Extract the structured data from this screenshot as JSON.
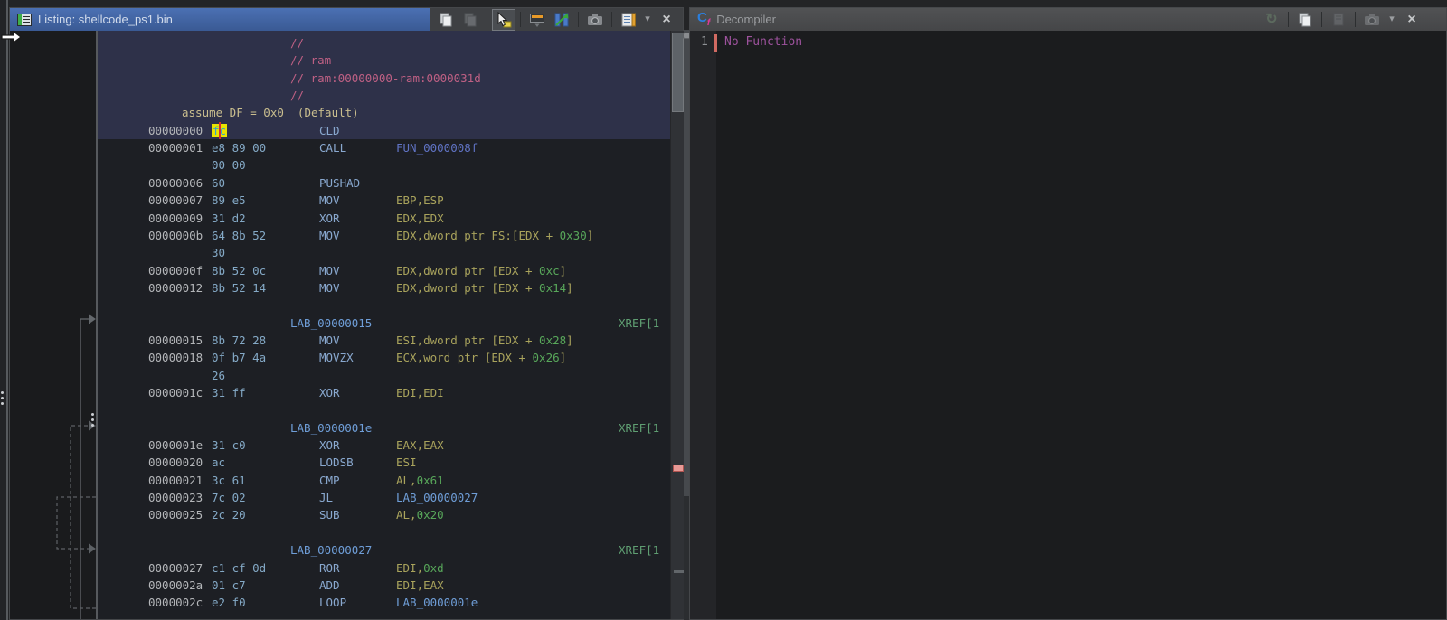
{
  "listing": {
    "title": "Listing:  shellcode_ps1.bin",
    "toolbar_icons": [
      "copy-icon",
      "paste-icon",
      "select-tool-icon",
      "edit-listing-fields-icon",
      "diff-view-icon",
      "snapshot-icon",
      "listing-display-options-icon",
      "dropdown-caret-icon",
      "close-icon"
    ],
    "header_icon": "listing-icon",
    "assume_line": "assume DF = 0x0  (Default)",
    "cursor_byte": "fc",
    "rows": [
      [
        {
          "c": "com",
          "p": [
            [
              "com",
              "//"
            ]
          ]
        }
      ],
      [
        {
          "c": "com",
          "p": [
            [
              "com",
              "// ram"
            ]
          ]
        }
      ],
      [
        {
          "c": "com",
          "p": [
            [
              "com",
              "// ram:00000000-ram:0000031d"
            ]
          ]
        }
      ],
      [
        {
          "c": "com",
          "p": [
            [
              "com",
              "//"
            ]
          ]
        }
      ],
      [
        {
          "c": "assume",
          "p": [
            [
              "assume",
              "assume DF = 0x0  (Default)"
            ]
          ]
        }
      ],
      [
        {
          "c": "addr",
          "p": [
            [
              "addr",
              "00000000"
            ]
          ]
        },
        {
          "c": "bytehl",
          "p": [
            [
              "bytehl",
              "fc"
            ]
          ]
        },
        {
          "c": "mnem",
          "p": [
            [
              "mnem",
              "CLD"
            ]
          ]
        }
      ],
      [
        {
          "c": "addr",
          "p": [
            [
              "addr",
              "00000001"
            ]
          ]
        },
        {
          "c": "byte",
          "p": [
            [
              "byte",
              "e8 89 00"
            ]
          ]
        },
        {
          "c": "mnem",
          "p": [
            [
              "mnem",
              "CALL"
            ]
          ]
        },
        {
          "c": "op",
          "p": [
            [
              "fun",
              "FUN_0000008f"
            ]
          ]
        }
      ],
      [
        {
          "c": "byte",
          "p": [
            [
              "byte",
              "00 00"
            ]
          ]
        }
      ],
      [
        {
          "c": "addr",
          "p": [
            [
              "addr",
              "00000006"
            ]
          ]
        },
        {
          "c": "byte",
          "p": [
            [
              "byte",
              "60"
            ]
          ]
        },
        {
          "c": "mnem",
          "p": [
            [
              "mnem",
              "PUSHAD"
            ]
          ]
        }
      ],
      [
        {
          "c": "addr",
          "p": [
            [
              "addr",
              "00000007"
            ]
          ]
        },
        {
          "c": "byte",
          "p": [
            [
              "byte",
              "89 e5"
            ]
          ]
        },
        {
          "c": "mnem",
          "p": [
            [
              "mnem",
              "MOV"
            ]
          ]
        },
        {
          "c": "op",
          "p": [
            [
              "reg",
              "EBP,ESP"
            ]
          ]
        }
      ],
      [
        {
          "c": "addr",
          "p": [
            [
              "addr",
              "00000009"
            ]
          ]
        },
        {
          "c": "byte",
          "p": [
            [
              "byte",
              "31 d2"
            ]
          ]
        },
        {
          "c": "mnem",
          "p": [
            [
              "mnem",
              "XOR"
            ]
          ]
        },
        {
          "c": "op",
          "p": [
            [
              "reg",
              "EDX,EDX"
            ]
          ]
        }
      ],
      [
        {
          "c": "addr",
          "p": [
            [
              "addr",
              "0000000b"
            ]
          ]
        },
        {
          "c": "byte",
          "p": [
            [
              "byte",
              "64 8b 52"
            ]
          ]
        },
        {
          "c": "mnem",
          "p": [
            [
              "mnem",
              "MOV"
            ]
          ]
        },
        {
          "c": "op",
          "p": [
            [
              "reg",
              "EDX,dword ptr FS:[EDX + "
            ],
            [
              "num",
              "0x30"
            ],
            [
              "reg",
              "]"
            ]
          ]
        }
      ],
      [
        {
          "c": "byte",
          "p": [
            [
              "byte",
              "30"
            ]
          ]
        }
      ],
      [
        {
          "c": "addr",
          "p": [
            [
              "addr",
              "0000000f"
            ]
          ]
        },
        {
          "c": "byte",
          "p": [
            [
              "byte",
              "8b 52 0c"
            ]
          ]
        },
        {
          "c": "mnem",
          "p": [
            [
              "mnem",
              "MOV"
            ]
          ]
        },
        {
          "c": "op",
          "p": [
            [
              "reg",
              "EDX,dword ptr [EDX + "
            ],
            [
              "num",
              "0xc"
            ],
            [
              "reg",
              "]"
            ]
          ]
        }
      ],
      [
        {
          "c": "addr",
          "p": [
            [
              "addr",
              "00000012"
            ]
          ]
        },
        {
          "c": "byte",
          "p": [
            [
              "byte",
              "8b 52 14"
            ]
          ]
        },
        {
          "c": "mnem",
          "p": [
            [
              "mnem",
              "MOV"
            ]
          ]
        },
        {
          "c": "op",
          "p": [
            [
              "reg",
              "EDX,dword ptr [EDX + "
            ],
            [
              "num",
              "0x14"
            ],
            [
              "reg",
              "]"
            ]
          ]
        }
      ],
      [],
      [
        {
          "c": "lab",
          "p": [
            [
              "lab",
              "LAB_00000015"
            ]
          ]
        },
        {
          "c": "xref",
          "p": [
            [
              "xref",
              "XREF[1"
            ]
          ]
        }
      ],
      [
        {
          "c": "addr",
          "p": [
            [
              "addr",
              "00000015"
            ]
          ]
        },
        {
          "c": "byte",
          "p": [
            [
              "byte",
              "8b 72 28"
            ]
          ]
        },
        {
          "c": "mnem",
          "p": [
            [
              "mnem",
              "MOV"
            ]
          ]
        },
        {
          "c": "op",
          "p": [
            [
              "reg",
              "ESI,dword ptr [EDX + "
            ],
            [
              "num",
              "0x28"
            ],
            [
              "reg",
              "]"
            ]
          ]
        }
      ],
      [
        {
          "c": "addr",
          "p": [
            [
              "addr",
              "00000018"
            ]
          ]
        },
        {
          "c": "byte",
          "p": [
            [
              "byte",
              "0f b7 4a"
            ]
          ]
        },
        {
          "c": "mnem",
          "p": [
            [
              "mnem",
              "MOVZX"
            ]
          ]
        },
        {
          "c": "op",
          "p": [
            [
              "reg",
              "ECX,word ptr [EDX + "
            ],
            [
              "num",
              "0x26"
            ],
            [
              "reg",
              "]"
            ]
          ]
        }
      ],
      [
        {
          "c": "byte",
          "p": [
            [
              "byte",
              "26"
            ]
          ]
        }
      ],
      [
        {
          "c": "addr",
          "p": [
            [
              "addr",
              "0000001c"
            ]
          ]
        },
        {
          "c": "byte",
          "p": [
            [
              "byte",
              "31 ff"
            ]
          ]
        },
        {
          "c": "mnem",
          "p": [
            [
              "mnem",
              "XOR"
            ]
          ]
        },
        {
          "c": "op",
          "p": [
            [
              "reg",
              "EDI,EDI"
            ]
          ]
        }
      ],
      [],
      [
        {
          "c": "lab",
          "p": [
            [
              "lab",
              "LAB_0000001e"
            ]
          ]
        },
        {
          "c": "xref",
          "p": [
            [
              "xref",
              "XREF[1"
            ]
          ]
        }
      ],
      [
        {
          "c": "addr",
          "p": [
            [
              "addr",
              "0000001e"
            ]
          ]
        },
        {
          "c": "byte",
          "p": [
            [
              "byte",
              "31 c0"
            ]
          ]
        },
        {
          "c": "mnem",
          "p": [
            [
              "mnem",
              "XOR"
            ]
          ]
        },
        {
          "c": "op",
          "p": [
            [
              "reg",
              "EAX,EAX"
            ]
          ]
        }
      ],
      [
        {
          "c": "addr",
          "p": [
            [
              "addr",
              "00000020"
            ]
          ]
        },
        {
          "c": "byte",
          "p": [
            [
              "byte",
              "ac"
            ]
          ]
        },
        {
          "c": "mnem",
          "p": [
            [
              "mnem",
              "LODSB"
            ]
          ]
        },
        {
          "c": "op",
          "p": [
            [
              "reg",
              "ESI"
            ]
          ]
        }
      ],
      [
        {
          "c": "addr",
          "p": [
            [
              "addr",
              "00000021"
            ]
          ]
        },
        {
          "c": "byte",
          "p": [
            [
              "byte",
              "3c 61"
            ]
          ]
        },
        {
          "c": "mnem",
          "p": [
            [
              "mnem",
              "CMP"
            ]
          ]
        },
        {
          "c": "op",
          "p": [
            [
              "reg",
              "AL,"
            ],
            [
              "num",
              "0x61"
            ]
          ]
        }
      ],
      [
        {
          "c": "addr",
          "p": [
            [
              "addr",
              "00000023"
            ]
          ]
        },
        {
          "c": "byte",
          "p": [
            [
              "byte",
              "7c 02"
            ]
          ]
        },
        {
          "c": "mnem",
          "p": [
            [
              "mnem",
              "JL"
            ]
          ]
        },
        {
          "c": "op",
          "p": [
            [
              "lab",
              "LAB_00000027"
            ]
          ]
        }
      ],
      [
        {
          "c": "addr",
          "p": [
            [
              "addr",
              "00000025"
            ]
          ]
        },
        {
          "c": "byte",
          "p": [
            [
              "byte",
              "2c 20"
            ]
          ]
        },
        {
          "c": "mnem",
          "p": [
            [
              "mnem",
              "SUB"
            ]
          ]
        },
        {
          "c": "op",
          "p": [
            [
              "reg",
              "AL,"
            ],
            [
              "num",
              "0x20"
            ]
          ]
        }
      ],
      [],
      [
        {
          "c": "lab",
          "p": [
            [
              "lab",
              "LAB_00000027"
            ]
          ]
        },
        {
          "c": "xref",
          "p": [
            [
              "xref",
              "XREF[1"
            ]
          ]
        }
      ],
      [
        {
          "c": "addr",
          "p": [
            [
              "addr",
              "00000027"
            ]
          ]
        },
        {
          "c": "byte",
          "p": [
            [
              "byte",
              "c1 cf 0d"
            ]
          ]
        },
        {
          "c": "mnem",
          "p": [
            [
              "mnem",
              "ROR"
            ]
          ]
        },
        {
          "c": "op",
          "p": [
            [
              "reg",
              "EDI,"
            ],
            [
              "num",
              "0xd"
            ]
          ]
        }
      ],
      [
        {
          "c": "addr",
          "p": [
            [
              "addr",
              "0000002a"
            ]
          ]
        },
        {
          "c": "byte",
          "p": [
            [
              "byte",
              "01 c7"
            ]
          ]
        },
        {
          "c": "mnem",
          "p": [
            [
              "mnem",
              "ADD"
            ]
          ]
        },
        {
          "c": "op",
          "p": [
            [
              "reg",
              "EDI,EAX"
            ]
          ]
        }
      ],
      [
        {
          "c": "addr",
          "p": [
            [
              "addr",
              "0000002c"
            ]
          ]
        },
        {
          "c": "byte",
          "p": [
            [
              "byte",
              "e2 f0"
            ]
          ]
        },
        {
          "c": "mnem",
          "p": [
            [
              "mnem",
              "LOOP"
            ]
          ]
        },
        {
          "c": "op",
          "p": [
            [
              "lab",
              "LAB_0000001e"
            ]
          ]
        }
      ]
    ]
  },
  "decompiler": {
    "title": "Decompiler",
    "header_icon": "c-function-icon",
    "toolbar_icons": [
      "refresh-icon",
      "copy-icon",
      "export-icon",
      "snapshot-icon",
      "dropdown-caret-icon",
      "close-icon"
    ],
    "line_number": "1",
    "text": "No Function",
    "refresh_glyph": "↻",
    "caret_glyph": "▾",
    "close_glyph": "×"
  },
  "colors": {
    "active_titlebar": "#3f63a6",
    "inactive_titlebar": "#4b4c4e",
    "listing_bg": "#1d1f24",
    "selection_bg": "#2e3149",
    "address": "#b4b6b9",
    "bytes": "#84a9c6",
    "mnemonic": "#89a8cf",
    "register": "#a9a35c",
    "scalar": "#58a75a",
    "function_name": "#6073c4",
    "label": "#6f9ed8",
    "xref": "#5f9e72",
    "comment": "#bf6084",
    "assume": "#cabe8e",
    "byte_cursor_bg": "#e8e400",
    "cursor_line": "#d03030",
    "decompiler_text": "#9d529d",
    "current_line_bar": "#d06a62",
    "nav_marker_pink": "#e89a96"
  }
}
